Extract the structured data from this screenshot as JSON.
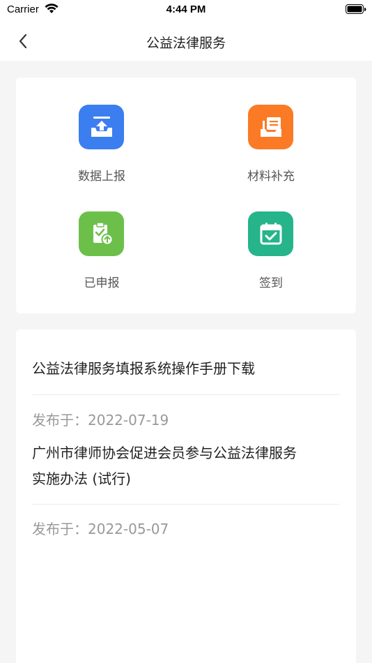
{
  "status_bar": {
    "carrier": "Carrier",
    "time": "4:44 PM"
  },
  "nav": {
    "title": "公益法律服务"
  },
  "services": [
    {
      "label": "数据上报",
      "icon": "upload-tray-icon",
      "color": "#3b7ef0"
    },
    {
      "label": "材料补充",
      "icon": "inbox-document-icon",
      "color": "#fb7a26"
    },
    {
      "label": "已申报",
      "icon": "clipboard-upload-icon",
      "color": "#6cc04a"
    },
    {
      "label": "签到",
      "icon": "calendar-check-icon",
      "color": "#26b48a"
    }
  ],
  "articles": [
    {
      "title": "公益法律服务填报系统操作手册下载",
      "date_prefix": "发布于：",
      "date": "2022-07-19"
    },
    {
      "title_line1": "广州市律师协会促进会员参与公益法律服务",
      "title_line2": "实施办法 (试行)",
      "date_prefix": "发布于：",
      "date": "2022-05-07"
    }
  ]
}
